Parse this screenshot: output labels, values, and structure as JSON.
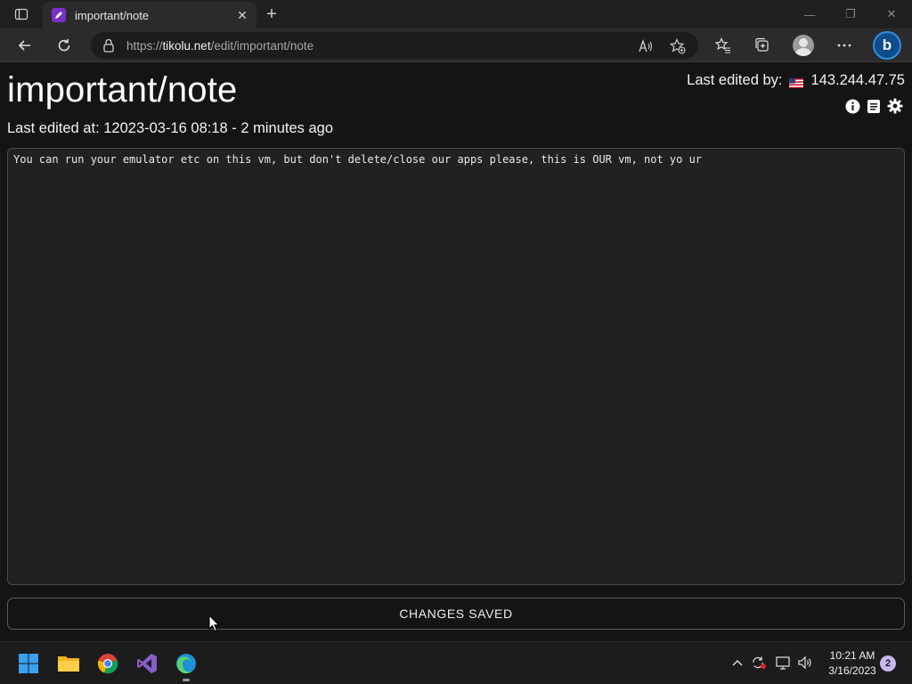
{
  "browser": {
    "tab": {
      "title": "important/note",
      "close_label": "✕"
    },
    "new_tab_label": "+",
    "window_controls": {
      "minimize": "—",
      "restore": "❐",
      "close": "✕"
    },
    "url": {
      "prefix": "https://",
      "host": "tikolu.net",
      "path": "/edit/important/note"
    }
  },
  "page": {
    "title": "important/note",
    "last_edited_at_label": "Last edited at: 12023-03-16  08:18 - 2 minutes ago",
    "last_edited_by_label": "Last edited by:",
    "editor_ip": "143.244.47.75",
    "note_text": "You can run your emulator etc on this vm, but don't delete/close our apps please, this is OUR vm, not yo ur",
    "status_button": "CHANGES SAVED"
  },
  "taskbar": {
    "clock_time": "10:21 AM",
    "clock_date": "3/16/2023",
    "notification_count": "2"
  },
  "colors": {
    "accent_purple": "#7b2fc9",
    "page_background": "#141414",
    "editor_background": "#212121"
  }
}
